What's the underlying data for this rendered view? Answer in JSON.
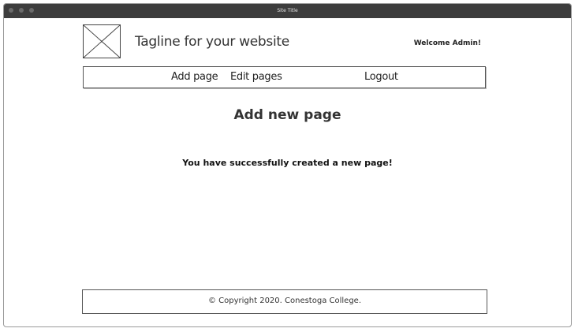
{
  "window": {
    "title": "Site Title"
  },
  "header": {
    "tagline": "Tagline for your website",
    "welcome": "Welcome Admin!"
  },
  "nav": {
    "items": [
      {
        "label": "Add page"
      },
      {
        "label": "Edit pages"
      },
      {
        "label": "Logout"
      }
    ]
  },
  "main": {
    "heading": "Add new page",
    "message": "You have successfully created a new page!"
  },
  "footer": {
    "text": "© Copyright 2020. Conestoga College."
  },
  "icons": {
    "logo": "image-placeholder-icon"
  },
  "colors": {
    "titlebar": "#3d3d3d",
    "border": "#555555",
    "text": "#333333"
  }
}
